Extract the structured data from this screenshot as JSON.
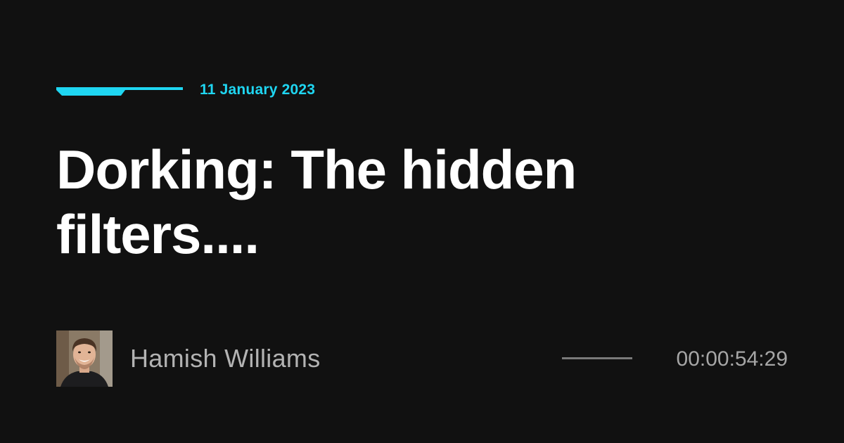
{
  "theme": {
    "background": "#111111",
    "accent": "#1fd6f2",
    "title_color": "#ffffff",
    "meta_color": "#b3b3b3"
  },
  "post": {
    "date": "11 January 2023",
    "title": "Dorking: The hidden filters...."
  },
  "author": {
    "name": "Hamish Williams",
    "avatar_icon": "author-photo"
  },
  "media": {
    "duration": "00:00:54:29"
  }
}
